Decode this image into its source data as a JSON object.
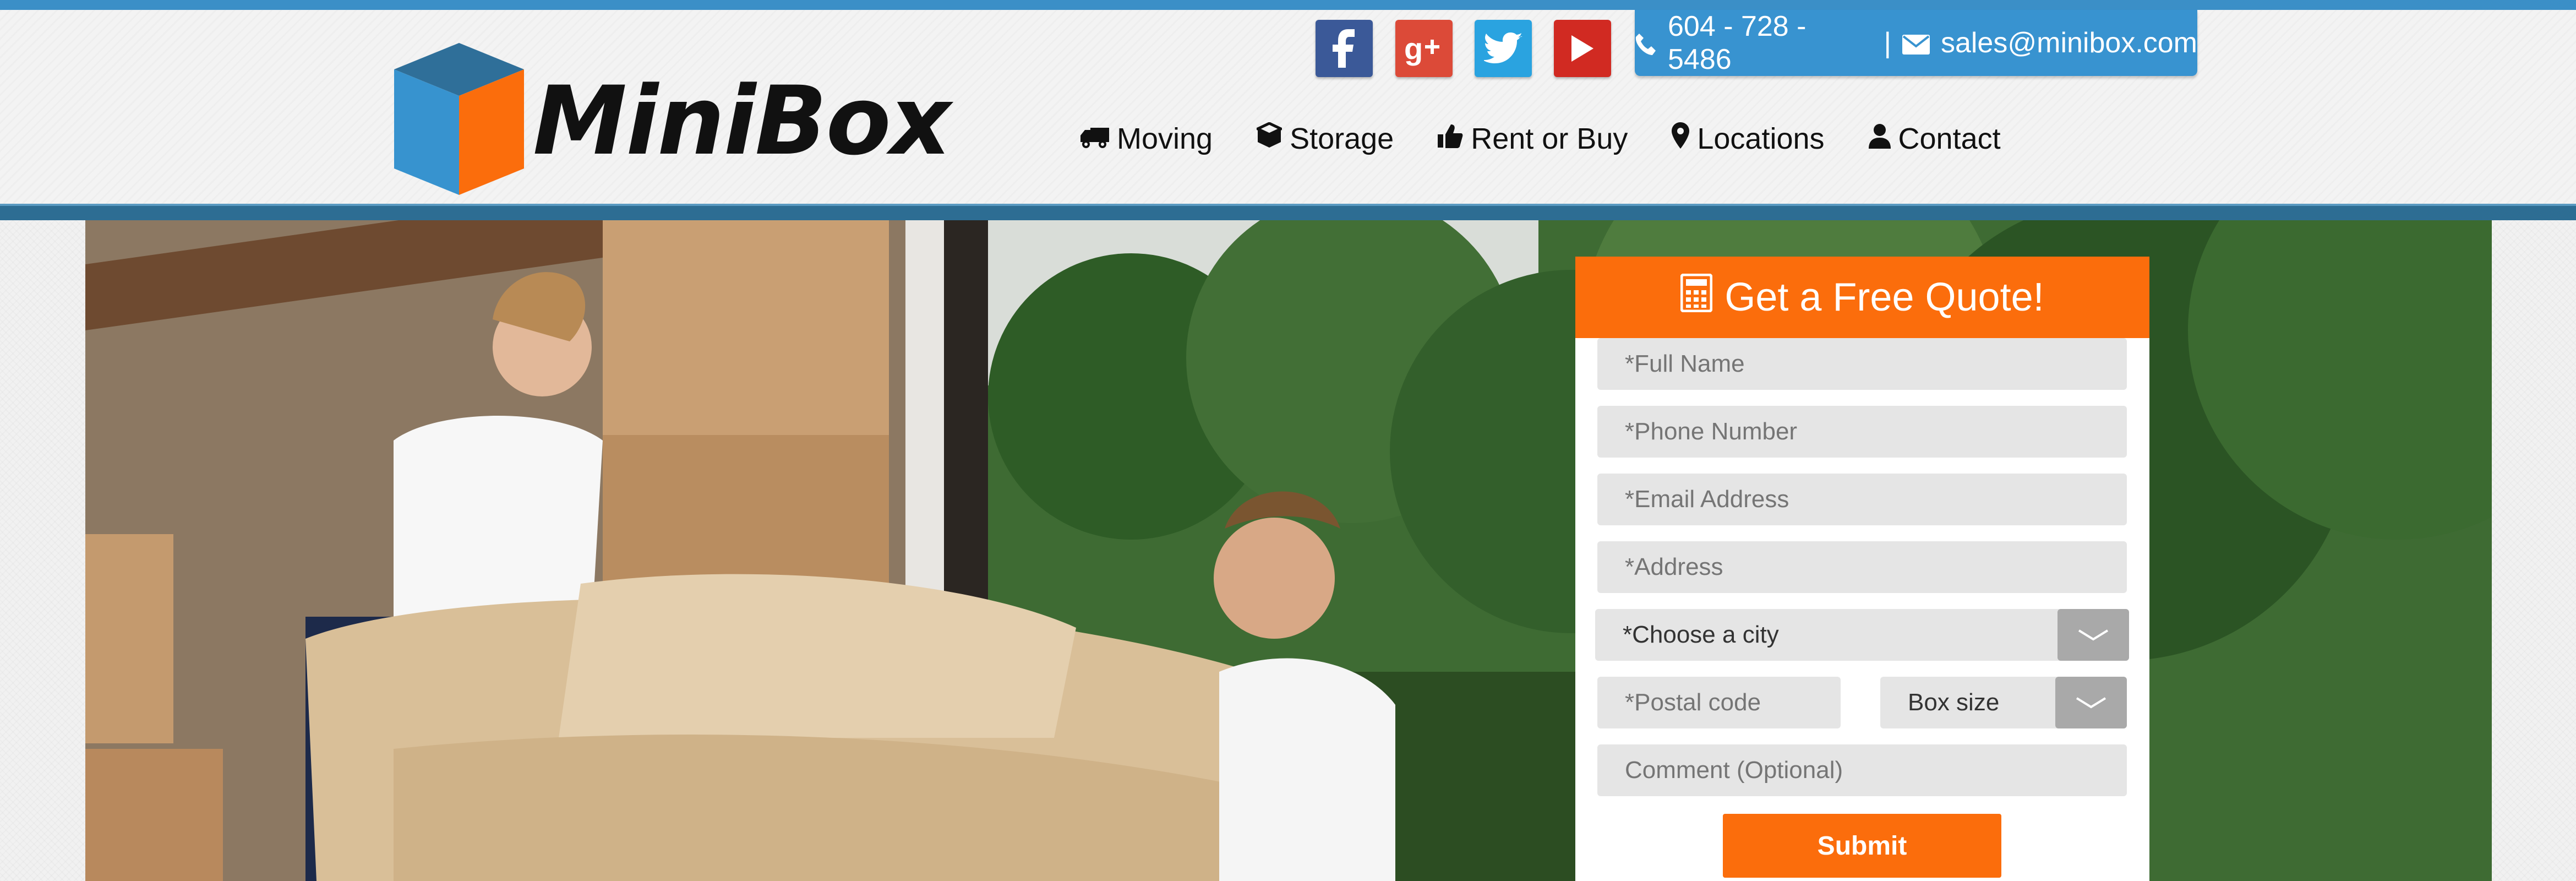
{
  "brand": {
    "name": "MiniBox"
  },
  "social": {
    "icons": [
      "facebook-icon",
      "google-plus-icon",
      "twitter-icon",
      "youtube-icon"
    ]
  },
  "contact": {
    "phone": "604 - 728 - 5486",
    "separator": "|",
    "email": "sales@minibox.com"
  },
  "nav": {
    "items": [
      {
        "label": "Moving",
        "icon": "truck-icon"
      },
      {
        "label": "Storage",
        "icon": "cube-icon"
      },
      {
        "label": "Rent or Buy",
        "icon": "thumbs-up-icon"
      },
      {
        "label": "Locations",
        "icon": "map-marker-icon"
      },
      {
        "label": "Contact",
        "icon": "user-icon"
      }
    ]
  },
  "quote_form": {
    "title": "Get a Free Quote!",
    "full_name": {
      "placeholder": "*Full Name"
    },
    "phone": {
      "placeholder": "*Phone Number"
    },
    "email": {
      "placeholder": "*Email Address"
    },
    "address": {
      "placeholder": "*Address"
    },
    "city": {
      "value": "*Choose a city"
    },
    "postal": {
      "placeholder": "*Postal code"
    },
    "box_size": {
      "value": "Box size"
    },
    "comment": {
      "placeholder": "Comment (Optional)"
    },
    "submit_label": "Submit"
  },
  "colors": {
    "accent_orange": "#fb6d0c",
    "brand_blue": "#3893d0",
    "dark_blue": "#2d6d93"
  }
}
